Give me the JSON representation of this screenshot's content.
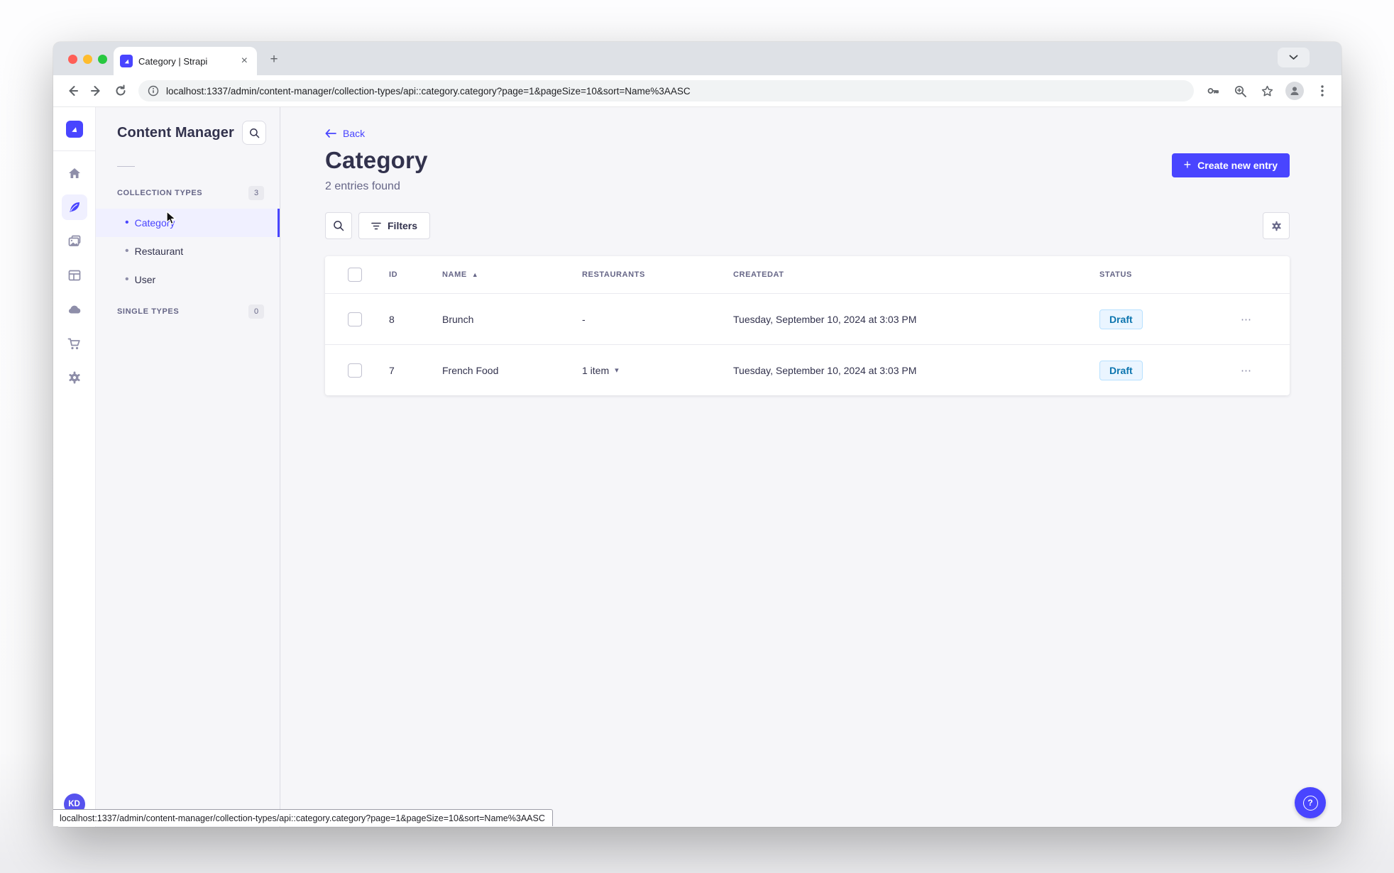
{
  "browser": {
    "tab_title": "Category | Strapi",
    "url": "localhost:1337/admin/content-manager/collection-types/api::category.category?page=1&pageSize=10&sort=Name%3AASC",
    "status_bar_url": "localhost:1337/admin/content-manager/collection-types/api::category.category?page=1&pageSize=10&sort=Name%3AASC"
  },
  "nav": {
    "title": "Content Manager",
    "collection_types": {
      "label": "COLLECTION TYPES",
      "count": "3"
    },
    "items": [
      {
        "label": "Category"
      },
      {
        "label": "Restaurant"
      },
      {
        "label": "User"
      }
    ],
    "single_types": {
      "label": "SINGLE TYPES",
      "count": "0"
    }
  },
  "header": {
    "back": "Back",
    "title": "Category",
    "subtitle": "2 entries found",
    "create_button": "Create new entry"
  },
  "filters": {
    "label": "Filters"
  },
  "table": {
    "headers": {
      "id": "ID",
      "name": "NAME",
      "restaurants": "RESTAURANTS",
      "createdat": "CREATEDAT",
      "status": "STATUS"
    },
    "rows": [
      {
        "id": "8",
        "name": "Brunch",
        "restaurants": "-",
        "createdat": "Tuesday, September 10, 2024 at 3:03 PM",
        "status": "Draft"
      },
      {
        "id": "7",
        "name": "French Food",
        "restaurants": "1 item",
        "createdat": "Tuesday, September 10, 2024 at 3:03 PM",
        "status": "Draft"
      }
    ]
  },
  "user": {
    "initials": "KD"
  },
  "glyphs": {
    "close": "×",
    "plus": "+",
    "bullet": "•",
    "sort_asc": "▲",
    "caret_down": "▾",
    "dots_h": "⋯"
  },
  "colors": {
    "primary": "#4945ff",
    "active_bg": "#f0f0ff",
    "text_dark": "#32324d",
    "text_gray": "#666687",
    "draft_bg": "#eaf5ff",
    "draft_border": "#b8e1ff",
    "draft_text": "#0c75af",
    "traffic_red": "#ff5f57",
    "traffic_yellow": "#febc2e",
    "traffic_green": "#28c840"
  }
}
